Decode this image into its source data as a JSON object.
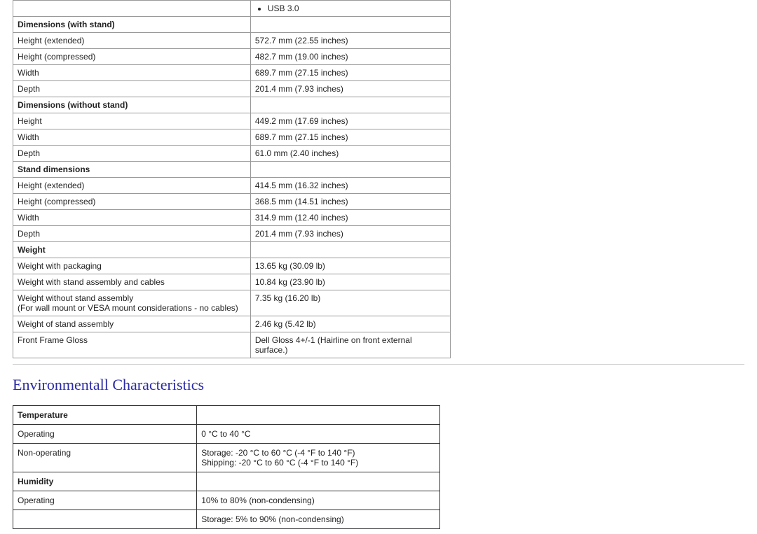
{
  "usb_item": "USB 3.0",
  "spec_sections": [
    {
      "title": "Dimensions (with stand)",
      "rows": [
        {
          "label": "Height (extended)",
          "value": "572.7 mm (22.55 inches)"
        },
        {
          "label": "Height (compressed)",
          "value": "482.7 mm (19.00 inches)"
        },
        {
          "label": "Width",
          "value": "689.7 mm (27.15 inches)"
        },
        {
          "label": "Depth",
          "value": "201.4 mm (7.93 inches)"
        }
      ]
    },
    {
      "title": "Dimensions (without stand)",
      "rows": [
        {
          "label": "Height",
          "value": "449.2 mm (17.69 inches)"
        },
        {
          "label": "Width",
          "value": "689.7 mm (27.15 inches)"
        },
        {
          "label": "Depth",
          "value": "61.0 mm (2.40 inches)"
        }
      ]
    },
    {
      "title": "Stand dimensions",
      "rows": [
        {
          "label": "Height (extended)",
          "value": "414.5 mm (16.32 inches)"
        },
        {
          "label": "Height (compressed)",
          "value": "368.5 mm (14.51 inches)"
        },
        {
          "label": "Width",
          "value": "314.9 mm (12.40 inches)"
        },
        {
          "label": "Depth",
          "value": "201.4 mm (7.93 inches)"
        }
      ]
    },
    {
      "title": "Weight",
      "rows": [
        {
          "label": "Weight with packaging",
          "value": "13.65 kg (30.09 lb)"
        },
        {
          "label": "Weight with stand assembly and cables",
          "value": "10.84 kg (23.90 lb)"
        },
        {
          "label": "Weight without stand assembly\n(For wall mount or VESA mount considerations - no cables)",
          "value": "7.35 kg (16.20 lb)"
        },
        {
          "label": "Weight of stand assembly",
          "value": "2.46 kg (5.42 lb)"
        },
        {
          "label": "Front Frame Gloss",
          "value": "Dell Gloss 4+/-1 (Hairline on front external surface.)"
        }
      ]
    }
  ],
  "env_heading": "Environmentall Characteristics",
  "env_sections": [
    {
      "title": "Temperature",
      "rows": [
        {
          "label": "Operating",
          "value": "0 °C to 40 °C"
        },
        {
          "label": "Non-operating",
          "value": "Storage: -20 °C to 60 °C (-4 °F to 140 °F)\nShipping: -20 °C to 60 °C (-4 °F to 140 °F)"
        }
      ]
    },
    {
      "title": "Humidity",
      "rows": [
        {
          "label": "Operating",
          "value": "10% to 80% (non-condensing)"
        },
        {
          "label": "",
          "value": "Storage: 5% to 90% (non-condensing)",
          "cut": true
        }
      ]
    }
  ]
}
